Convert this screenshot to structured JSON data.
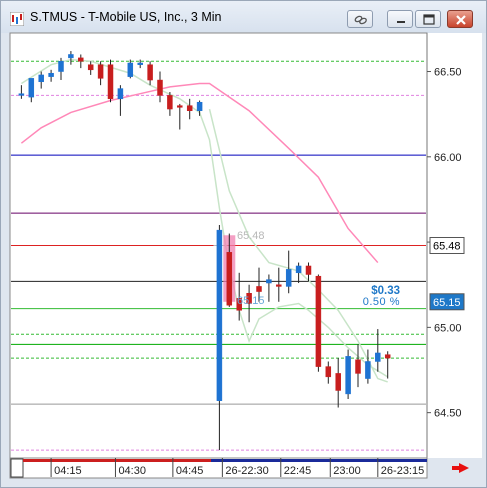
{
  "window": {
    "title": "S.TMUS - T-Mobile US, Inc., 3 Min",
    "icons": {
      "app": "chart-app-icon",
      "link": "link-icon",
      "minimize": "minimize-icon",
      "maximize": "maximize-icon",
      "close": "close-icon",
      "scroll": "scroll-right-arrow-icon"
    }
  },
  "chart_data": {
    "type": "candlestick",
    "title": "S.TMUS - T-Mobile US, Inc., 3 Min",
    "ylim": [
      64.24,
      66.72
    ],
    "y_ticks": [
      "66.50",
      "66.00",
      "65.50",
      "65.00",
      "64.50"
    ],
    "x_tick_labels": [
      "04:15",
      "04:30",
      "04:45",
      "26-22:30",
      "22:45",
      "23:00",
      "26-23:15"
    ],
    "price_badges": [
      {
        "label": "65.48",
        "value": 65.48,
        "bg": "#ffffff",
        "fg": "#000000"
      },
      {
        "label": "65.15",
        "value": 65.15,
        "bg": "#1e78c8",
        "fg": "#ffffff"
      }
    ],
    "annotations": {
      "level_label": "65.48",
      "low_label": "65.15",
      "change": "$0.33",
      "change_pct": "0.50 %"
    },
    "colors": {
      "up": "#1e73d2",
      "down": "#c81e1e",
      "session_shade": "#f080b0"
    },
    "candles": [
      {
        "slot": 1,
        "o": 66.36,
        "h": 66.42,
        "l": 66.34,
        "c": 66.37
      },
      {
        "slot": 2,
        "o": 66.35,
        "h": 66.45,
        "l": 66.32,
        "c": 66.46
      },
      {
        "slot": 3,
        "o": 66.44,
        "h": 66.5,
        "l": 66.4,
        "c": 66.48
      },
      {
        "slot": 4,
        "o": 66.47,
        "h": 66.51,
        "l": 66.44,
        "c": 66.49
      },
      {
        "slot": 5,
        "o": 66.5,
        "h": 66.58,
        "l": 66.45,
        "c": 66.56
      },
      {
        "slot": 6,
        "o": 66.58,
        "h": 66.62,
        "l": 66.54,
        "c": 66.6
      },
      {
        "slot": 7,
        "o": 66.58,
        "h": 66.6,
        "l": 66.52,
        "c": 66.56
      },
      {
        "slot": 8,
        "o": 66.54,
        "h": 66.56,
        "l": 66.48,
        "c": 66.51
      },
      {
        "slot": 9,
        "o": 66.54,
        "h": 66.56,
        "l": 66.42,
        "c": 66.46
      },
      {
        "slot": 10,
        "o": 66.54,
        "h": 66.57,
        "l": 66.32,
        "c": 66.34
      },
      {
        "slot": 11,
        "o": 66.34,
        "h": 66.42,
        "l": 66.24,
        "c": 66.4
      },
      {
        "slot": 12,
        "o": 66.47,
        "h": 66.57,
        "l": 66.46,
        "c": 66.55
      },
      {
        "slot": 13,
        "o": 66.54,
        "h": 66.57,
        "l": 66.52,
        "c": 66.55
      },
      {
        "slot": 14,
        "o": 66.54,
        "h": 66.56,
        "l": 66.42,
        "c": 66.45
      },
      {
        "slot": 15,
        "o": 66.45,
        "h": 66.5,
        "l": 66.32,
        "c": 66.36
      },
      {
        "slot": 16,
        "o": 66.36,
        "h": 66.38,
        "l": 66.24,
        "c": 66.28
      },
      {
        "slot": 17,
        "o": 66.3,
        "h": 66.31,
        "l": 66.16,
        "c": 66.29
      },
      {
        "slot": 18,
        "o": 66.3,
        "h": 66.34,
        "l": 66.22,
        "c": 66.27
      },
      {
        "slot": 19,
        "o": 66.27,
        "h": 66.33,
        "l": 66.24,
        "c": 66.32
      },
      {
        "slot": 21,
        "o": 64.57,
        "h": 65.6,
        "l": 64.28,
        "c": 65.57
      },
      {
        "slot": 22,
        "o": 65.44,
        "h": 65.55,
        "l": 65.12,
        "c": 65.13
      },
      {
        "slot": 23,
        "o": 65.17,
        "h": 65.32,
        "l": 65.04,
        "c": 65.1
      },
      {
        "slot": 24,
        "o": 65.2,
        "h": 65.25,
        "l": 65.03,
        "c": 65.14
      },
      {
        "slot": 25,
        "o": 65.24,
        "h": 65.35,
        "l": 65.15,
        "c": 65.21
      },
      {
        "slot": 26,
        "o": 65.26,
        "h": 65.31,
        "l": 65.15,
        "c": 65.28
      },
      {
        "slot": 27,
        "o": 65.25,
        "h": 65.35,
        "l": 65.15,
        "c": 65.24
      },
      {
        "slot": 28,
        "o": 65.24,
        "h": 65.45,
        "l": 65.2,
        "c": 65.34
      },
      {
        "slot": 29,
        "o": 65.32,
        "h": 65.38,
        "l": 65.26,
        "c": 65.36
      },
      {
        "slot": 30,
        "o": 65.36,
        "h": 65.38,
        "l": 65.27,
        "c": 65.31
      },
      {
        "slot": 31,
        "o": 65.3,
        "h": 65.31,
        "l": 64.74,
        "c": 64.77
      },
      {
        "slot": 32,
        "o": 64.77,
        "h": 64.8,
        "l": 64.67,
        "c": 64.71
      },
      {
        "slot": 33,
        "o": 64.73,
        "h": 64.82,
        "l": 64.53,
        "c": 64.63
      },
      {
        "slot": 34,
        "o": 64.61,
        "h": 64.87,
        "l": 64.58,
        "c": 64.83
      },
      {
        "slot": 35,
        "o": 64.81,
        "h": 64.9,
        "l": 64.65,
        "c": 64.73
      },
      {
        "slot": 36,
        "o": 64.7,
        "h": 64.87,
        "l": 64.67,
        "c": 64.8
      },
      {
        "slot": 37,
        "o": 64.8,
        "h": 64.99,
        "l": 64.74,
        "c": 64.85
      },
      {
        "slot": 38,
        "o": 64.84,
        "h": 64.86,
        "l": 64.7,
        "c": 64.82
      }
    ],
    "horizontal_levels": [
      {
        "value": 66.56,
        "color": "#33bb33",
        "style": "dash"
      },
      {
        "value": 66.36,
        "color": "#e080e0",
        "style": "dash"
      },
      {
        "value": 66.01,
        "color": "#0000bb",
        "style": "solid"
      },
      {
        "value": 65.67,
        "color": "#660066",
        "style": "solid"
      },
      {
        "value": 65.48,
        "color": "#dd2222",
        "style": "solid"
      },
      {
        "value": 65.27,
        "color": "#222222",
        "style": "solid"
      },
      {
        "value": 65.11,
        "color": "#33bb33",
        "style": "solid"
      },
      {
        "value": 64.96,
        "color": "#33bb33",
        "style": "dash"
      },
      {
        "value": 64.9,
        "color": "#00aa00",
        "style": "solid"
      },
      {
        "value": 64.82,
        "color": "#33bb33",
        "style": "dash"
      },
      {
        "value": 64.55,
        "color": "#999999",
        "style": "solid"
      },
      {
        "value": 64.28,
        "color": "#e080e0",
        "style": "dash"
      }
    ],
    "moving_averages": [
      {
        "color": "#ff88b8",
        "points": [
          [
            1,
            66.08
          ],
          [
            3,
            66.17
          ],
          [
            6,
            66.26
          ],
          [
            10,
            66.33
          ],
          [
            13,
            66.37
          ],
          [
            16,
            66.41
          ],
          [
            19,
            66.43
          ],
          [
            20,
            66.43
          ],
          [
            24,
            66.27
          ],
          [
            28,
            66.05
          ],
          [
            31,
            65.88
          ],
          [
            34,
            65.58
          ],
          [
            37,
            65.38
          ]
        ]
      },
      {
        "color": "#c8e4c8",
        "points": [
          [
            1,
            66.43
          ],
          [
            4,
            66.54
          ],
          [
            6,
            66.57
          ],
          [
            8,
            66.56
          ],
          [
            12,
            66.49
          ],
          [
            14,
            66.42
          ],
          [
            17,
            66.34
          ],
          [
            19,
            66.26
          ],
          [
            20,
            66.1
          ],
          [
            21,
            65.7
          ],
          [
            22,
            65.35
          ],
          [
            23,
            65.1
          ],
          [
            24,
            64.92
          ],
          [
            25,
            65.05
          ],
          [
            27,
            65.12
          ],
          [
            29,
            65.14
          ],
          [
            30,
            65.1
          ],
          [
            32,
            65.0
          ],
          [
            34,
            64.88
          ],
          [
            36,
            64.78
          ],
          [
            38,
            64.71
          ]
        ]
      },
      {
        "color": "#c8e4c8",
        "points": [
          [
            20,
            66.28
          ],
          [
            22,
            65.8
          ],
          [
            24,
            65.53
          ],
          [
            26,
            65.38
          ],
          [
            29,
            65.33
          ],
          [
            31,
            65.22
          ],
          [
            33,
            65.1
          ],
          [
            35,
            64.92
          ],
          [
            37,
            64.7
          ],
          [
            38,
            64.68
          ]
        ]
      }
    ],
    "session_shade": {
      "slot": 22,
      "from": 65.15,
      "to": 65.54
    }
  }
}
